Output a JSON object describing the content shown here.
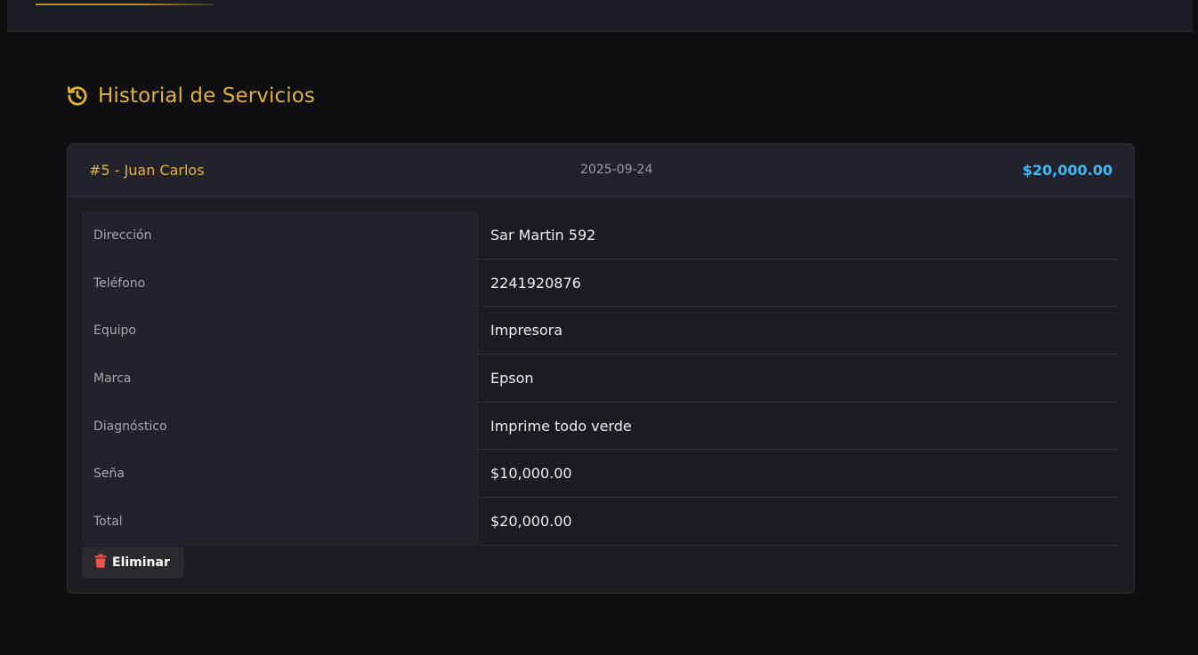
{
  "section": {
    "icon": "history-icon",
    "title": "Historial de Servicios"
  },
  "colors": {
    "accent": "#e0b13c",
    "amount": "#3fb8ef",
    "danger": "#ef5350",
    "background": "#0f0f12"
  },
  "service": {
    "id_name": "#5 - Juan Carlos",
    "date": "2025-09-24",
    "amount": "$20,000.00",
    "details": [
      {
        "label": "Dirección",
        "value": "Sar Martin 592"
      },
      {
        "label": "Teléfono",
        "value": "2241920876"
      },
      {
        "label": "Equipo",
        "value": "Impresora"
      },
      {
        "label": "Marca",
        "value": "Epson"
      },
      {
        "label": "Diagnóstico",
        "value": "Imprime todo verde"
      },
      {
        "label": "Seña",
        "value": "$10,000.00"
      },
      {
        "label": "Total",
        "value": "$20,000.00"
      }
    ],
    "delete_label": "Eliminar",
    "delete_icon": "trash-icon"
  }
}
